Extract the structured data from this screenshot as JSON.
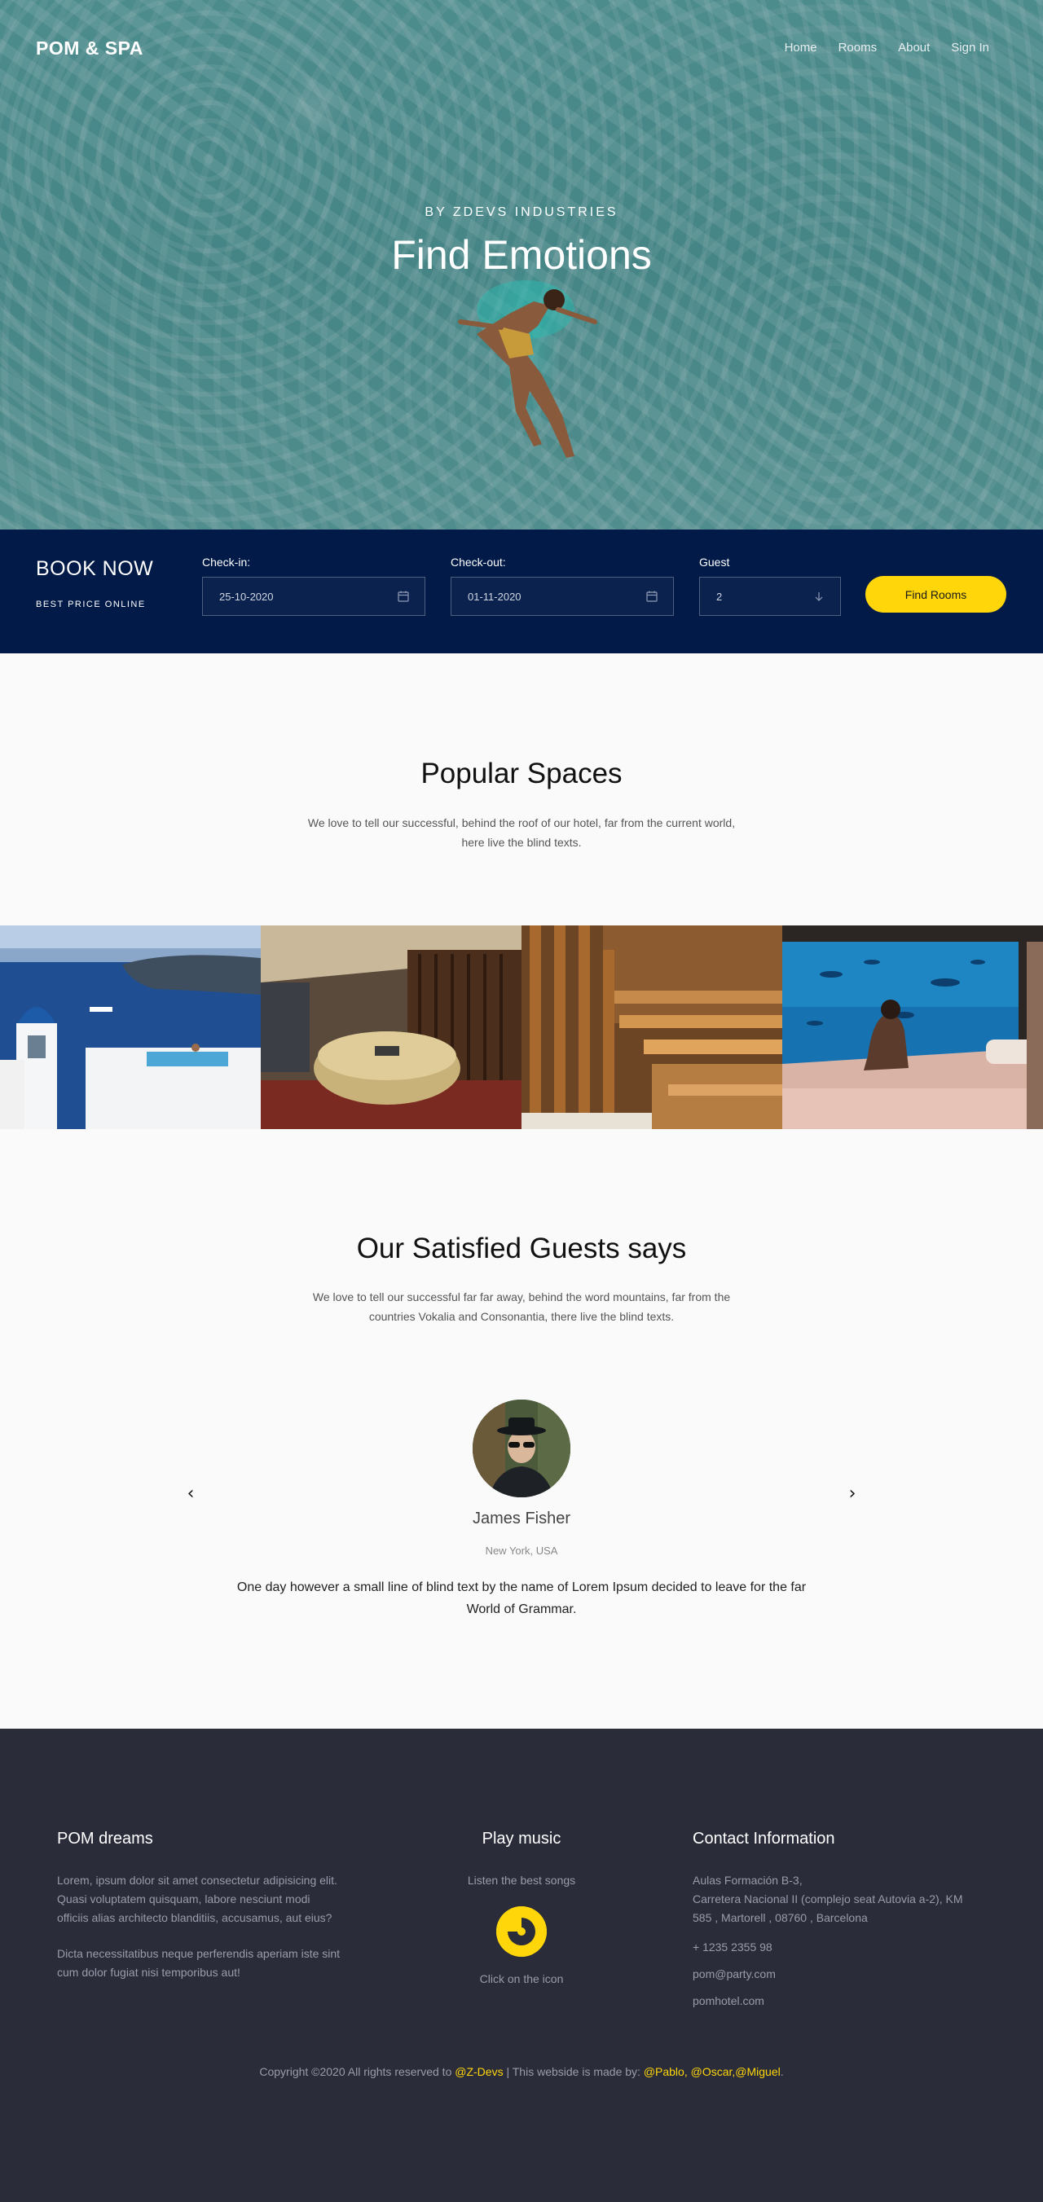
{
  "header": {
    "logo": "POM & SPA",
    "nav": [
      "Home",
      "Rooms",
      "About",
      "Sign In"
    ],
    "subtitle": "BY ZDEVS INDUSTRIES",
    "title": "Find Emotions"
  },
  "booking": {
    "title": "BOOK NOW",
    "subtitle": "BEST PRICE ONLINE",
    "checkin_label": "Check-in:",
    "checkin_value": "25-10-2020",
    "checkout_label": "Check-out:",
    "checkout_value": "01-11-2020",
    "guest_label": "Guest",
    "guest_value": "2",
    "button": "Find Rooms"
  },
  "popular": {
    "title": "Popular Spaces",
    "description_line1": "We love to tell our successful, behind the roof of our hotel, far from the current world,",
    "description_line2": "here live the blind texts.",
    "tiles": [
      "santorini-bell-tower",
      "round-bed-suite",
      "wooden-sauna",
      "aquarium-bedroom"
    ]
  },
  "testimonials": {
    "title": "Our Satisfied Guests says",
    "description_line1": "We love to tell our successful far far away, behind the word mountains, far from the",
    "description_line2": "countries Vokalia and Consonantia, there live the blind texts.",
    "name": "James Fisher",
    "location": "New York, USA",
    "quote_line1": "One day however a small line of blind text by the name of Lorem Ipsum decided to leave for the far",
    "quote_line2": "World of Grammar.",
    "prev": "‹",
    "next": "›"
  },
  "footer": {
    "col1_title": "POM dreams",
    "col1_p1_line1": "Lorem, ipsum dolor sit amet consectetur adipisicing elit.",
    "col1_p1_line2": "Quasi voluptatem quisquam, labore nesciunt modi",
    "col1_p1_line3": "officiis alias architecto blanditiis, accusamus, aut eius?",
    "col1_p2_line1": "Dicta necessitatibus neque perferendis aperiam iste sint",
    "col1_p2_line2": "cum dolor fugiat nisi temporibus aut!",
    "col2_title": "Play music",
    "col2_sub": "Listen the best songs",
    "col2_hint": "Click on the icon",
    "col3_title": "Contact Information",
    "address_line1": "Aulas Formación B-3,",
    "address_line2": "Carretera Nacional II (complejo seat Autovia a-2), KM",
    "address_line3": "585 , Martorell , 08760 , Barcelona",
    "phone": "+ 1235 2355 98",
    "email": "pom@party.com",
    "website": "pomhotel.com",
    "copyright_prefix": "Copyright ©2020 All rights reserved to",
    "copyright_brand": "@Z-Devs",
    "copyright_mid": "| This webside is made by:",
    "copyright_authors": "@Pablo, @Oscar,@Miguel",
    "copyright_end": "."
  },
  "colors": {
    "accent": "#ffd60a",
    "booking_bg": "#021a47",
    "footer_bg": "#2a2c3a"
  }
}
